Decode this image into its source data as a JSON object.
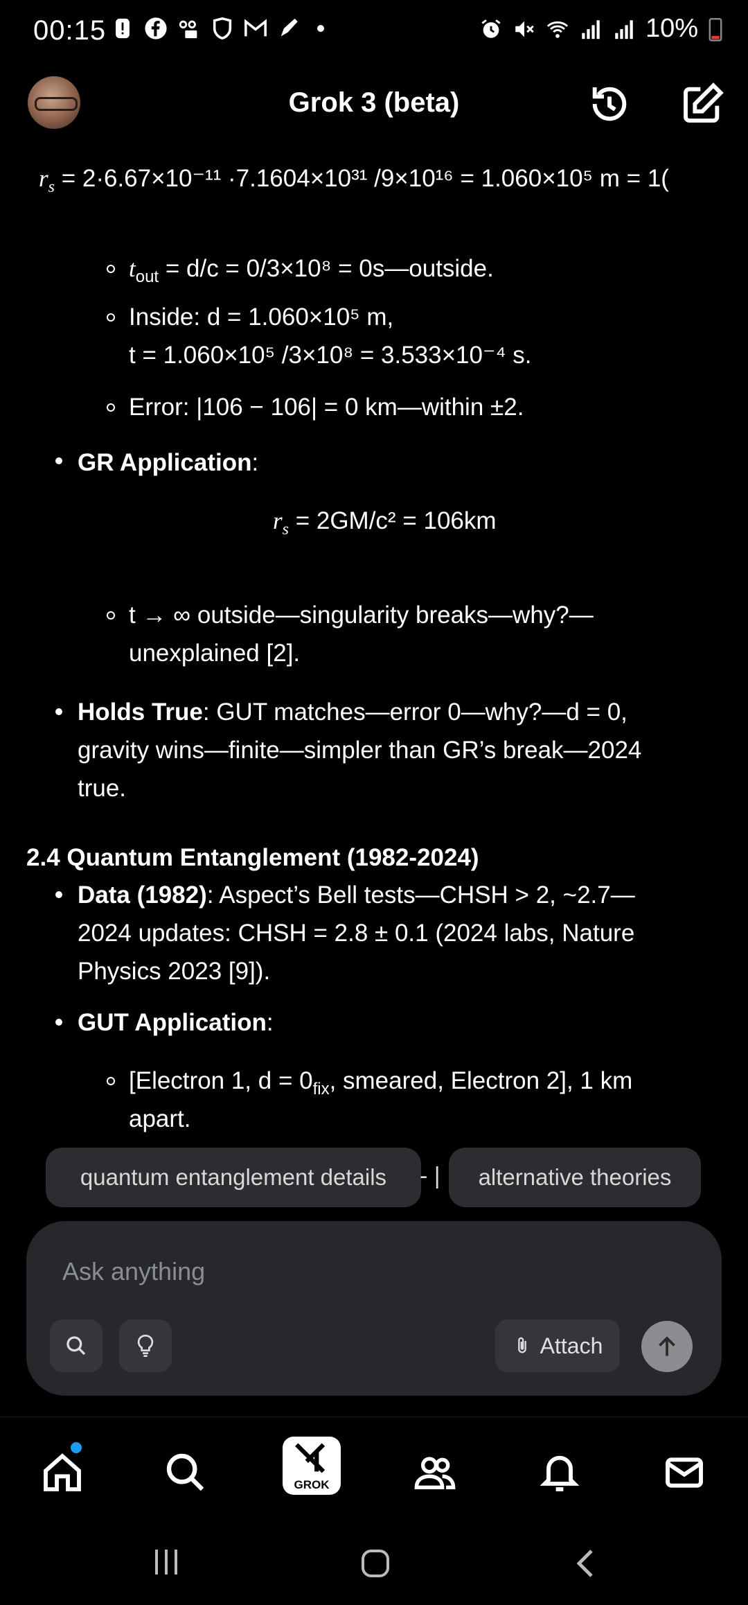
{
  "status": {
    "time": "00:15",
    "battery": "10%"
  },
  "header": {
    "title": "Grok 3 (beta)"
  },
  "content": {
    "rs_line": "= 2·6.67×10⁻¹¹ ·7.1604×10³¹ /9×10¹⁶ = 1.060×10⁵ m = 1(",
    "t_out": "= d/c = 0/3×10⁸ = 0s—outside.",
    "inside_1": "Inside: d = 1.060×10⁵ m,",
    "inside_2": "t = 1.060×10⁵ /3×10⁸ = 3.533×10⁻⁴ s.",
    "error": "Error: |106 − 106| = 0 km—within ±2.",
    "gr_heading": "GR Application",
    "gr_eq": "= 2GM/c² = 106km",
    "t_inf_1": "t → ∞ outside—singularity breaks—why?—",
    "t_inf_2": "unexplained [2].",
    "holds_label": "Holds True",
    "holds_text_1": ": GUT matches—error 0—why?—d = 0,",
    "holds_text_2": "gravity wins—finite—simpler than GR’s break—2024",
    "holds_text_3": "true.",
    "section": "2.4 Quantum Entanglement (1982-2024)",
    "data_label": "Data (1982)",
    "data_text_1": ": Aspect’s Bell tests—CHSH > 2, ~2.7—",
    "data_text_2": "2024 updates: CHSH = 2.8 ± 0.1 (2024 labs, Nature",
    "data_text_3": "Physics 2023 [9]).",
    "gut_heading": "GUT Application",
    "electron_1": "[Electron 1, d = 0",
    "electron_1b": "fix",
    "electron_1c": ", smeared, Electron 2], 1 km",
    "electron_2": "apart."
  },
  "suggestions": [
    "quantum entanglement details",
    "alternative theories"
  ],
  "suggestion_sep": "- |",
  "input": {
    "placeholder": "Ask anything",
    "attach_label": "Attach"
  },
  "nav": {
    "grok_label": "GROK"
  }
}
